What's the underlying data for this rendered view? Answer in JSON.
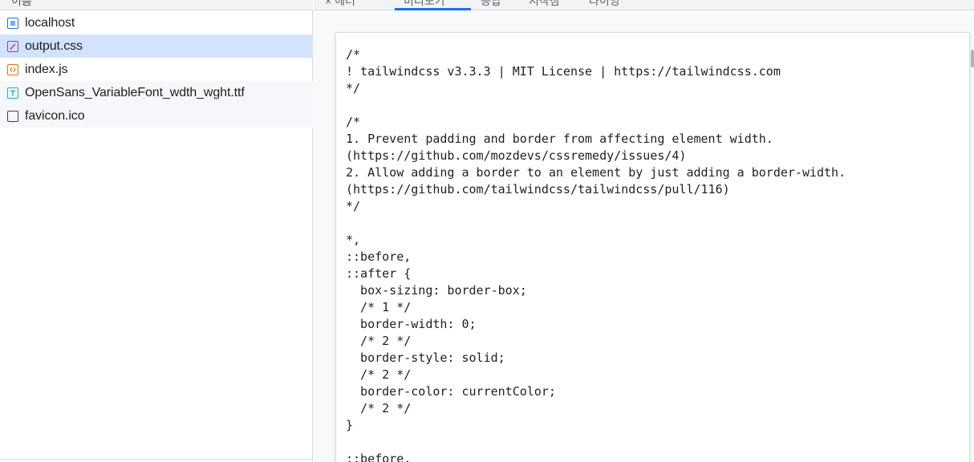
{
  "left_panel": {
    "header_fragment": "이름",
    "files": [
      {
        "name": "localhost",
        "icon": "document-icon",
        "type": "doc",
        "selected": false
      },
      {
        "name": "output.css",
        "icon": "css-file-icon",
        "type": "css",
        "selected": true
      },
      {
        "name": "index.js",
        "icon": "js-file-icon",
        "type": "js",
        "selected": false
      },
      {
        "name": "OpenSans_VariableFont_wdth_wght.ttf",
        "icon": "font-file-icon",
        "type": "font",
        "selected": false
      },
      {
        "name": "favicon.ico",
        "icon": "blank-file-icon",
        "type": "blank",
        "selected": false
      }
    ]
  },
  "tabs": [
    {
      "label": "×  헤더"
    },
    {
      "label": "미리보기"
    },
    {
      "label": "응답"
    },
    {
      "label": "시작점"
    },
    {
      "label": "타이밍"
    }
  ],
  "code_lines": [
    "/*",
    "! tailwindcss v3.3.3 | MIT License | https://tailwindcss.com",
    "*/",
    "",
    "/*",
    "1. Prevent padding and border from affecting element width.",
    "(https://github.com/mozdevs/cssremedy/issues/4)",
    "2. Allow adding a border to an element by just adding a border-width.",
    "(https://github.com/tailwindcss/tailwindcss/pull/116)",
    "*/",
    "",
    "*,",
    "::before,",
    "::after {",
    "  box-sizing: border-box;",
    "  /* 1 */",
    "  border-width: 0;",
    "  /* 2 */",
    "  border-style: solid;",
    "  /* 2 */",
    "  border-color: currentColor;",
    "  /* 2 */",
    "}",
    "",
    "::before,"
  ],
  "colors": {
    "selected_row": "#d3e3fd",
    "accent": "#1a73e8"
  }
}
